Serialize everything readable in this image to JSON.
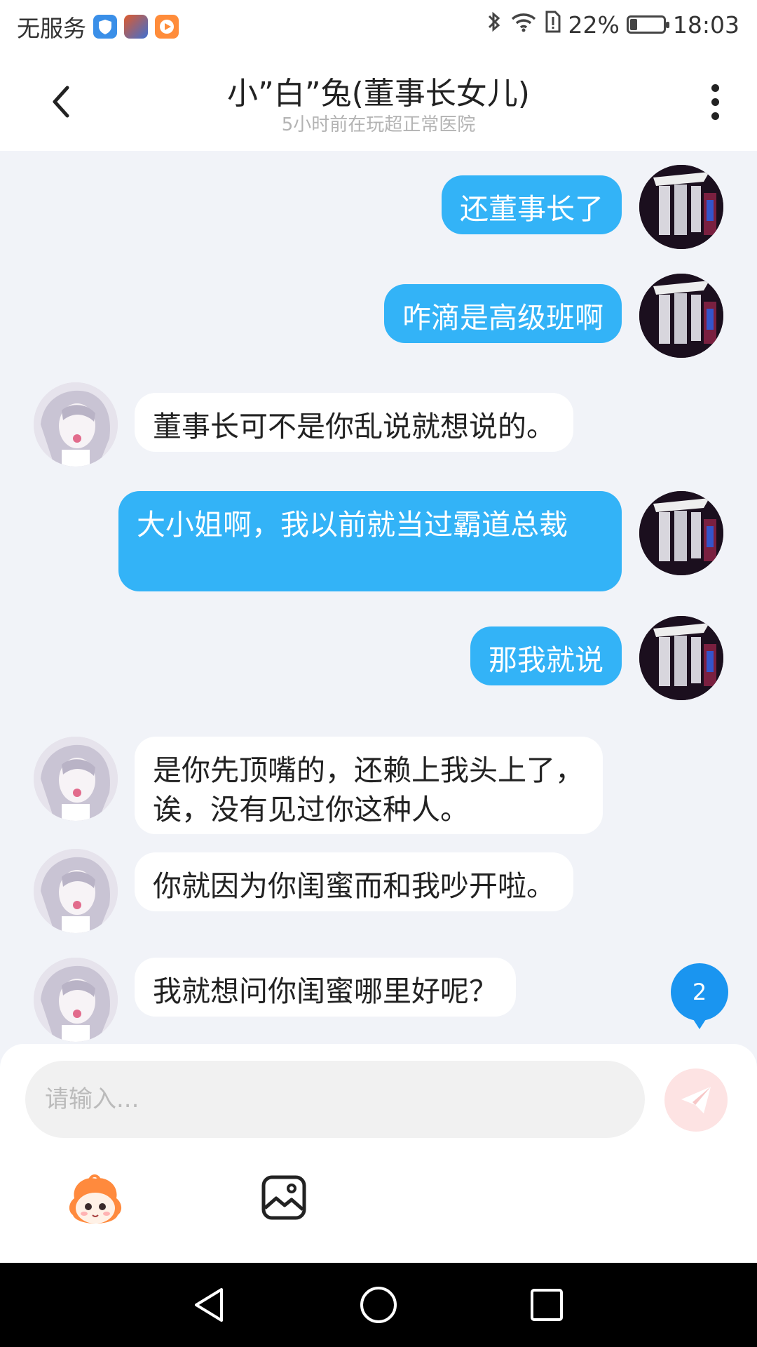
{
  "status_bar": {
    "carrier": "无服务",
    "battery_level": "22%",
    "battery_fraction": 0.22,
    "time": "18:03"
  },
  "header": {
    "title": "小”白”兔(董事长女儿)",
    "subtitle": "5小时前在玩超正常医院"
  },
  "messages": [
    {
      "sender": "me",
      "text": "还董事长了"
    },
    {
      "sender": "me",
      "text": "咋滴是高级班啊"
    },
    {
      "sender": "them",
      "text": "董事长可不是你乱说就想说的。"
    },
    {
      "sender": "me",
      "text": "大小姐啊，我以前就当过霸道总裁"
    },
    {
      "sender": "me",
      "text": "那我就说"
    },
    {
      "sender": "them",
      "text": "是你先顶嘴的，还赖上我头上了，诶，没有见过你这种人。"
    },
    {
      "sender": "them",
      "text": "你就因为你闺蜜而和我吵开啦。"
    },
    {
      "sender": "them",
      "text": "我就想问你闺蜜哪里好呢？"
    }
  ],
  "unread_badge": "2",
  "input": {
    "placeholder": "请输入..."
  },
  "colors": {
    "my_bubble": "#33b3f7",
    "their_bubble": "#ffffff",
    "background": "#f1f3f8",
    "badge": "#1a95f0"
  }
}
